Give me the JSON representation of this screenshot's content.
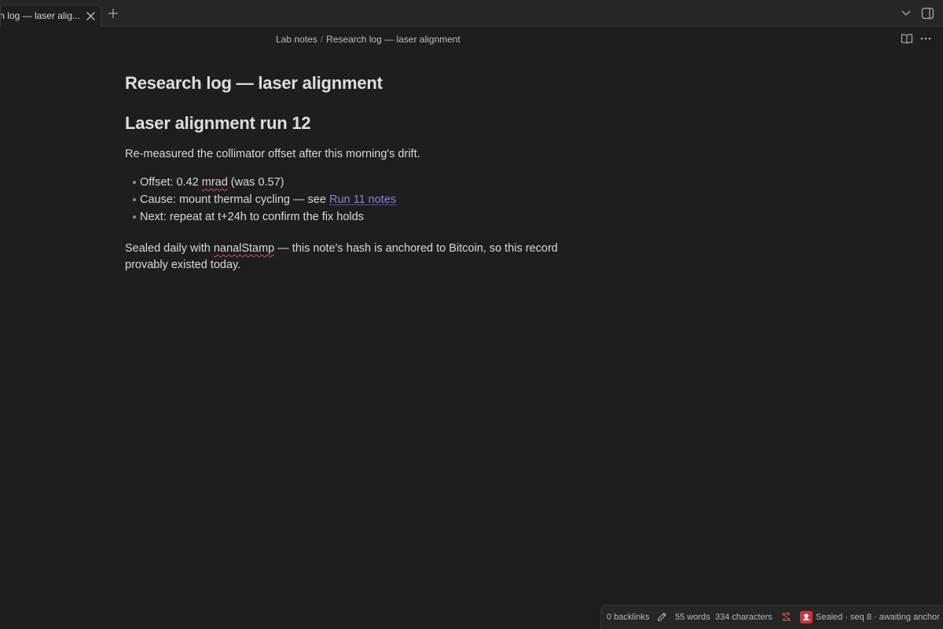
{
  "tabs": [
    {
      "title": "rch log — laser alig...",
      "active": true
    }
  ],
  "breadcrumb": {
    "folder": "Lab notes",
    "separator": "/",
    "current": "Research log — laser alignment"
  },
  "note": {
    "title": "Research log — laser alignment",
    "heading": "Laser alignment run 12",
    "intro": "Re-measured the collimator offset after this morning's drift.",
    "bullets": {
      "b1_before": "Offset: 0.42 ",
      "b1_flagged": "mrad",
      "b1_after": " (was 0.57)",
      "b2_text": "Cause: mount thermal cycling — see ",
      "b2_link": "Run 11 notes",
      "b3_text": "Next: repeat at t+24h to confirm the fix holds"
    },
    "outro_before": "Sealed daily with ",
    "outro_flagged": "nanalStamp",
    "outro_after": " — this note's hash is anchored to Bitcoin, so this record provably existed today."
  },
  "statusbar": {
    "backlinks": "0 backlinks",
    "words": "55 words",
    "characters": "334 characters",
    "stamp_status": "Sealed · seq 8 · awaiting anchor"
  },
  "icons": {
    "tab_close": "close-icon",
    "new_tab": "plus-icon",
    "tab_list": "chevron-down-icon",
    "sidebar": "sidebar-toggle-icon",
    "reading_view": "book-open-icon",
    "more": "more-horizontal-icon",
    "edit": "pencil-icon",
    "sync": "sync-off-icon",
    "stamp": "stamp-icon"
  },
  "colors": {
    "background": "#1e1e1e",
    "link": "#8c7ee0",
    "stamp_badge": "#c9363a",
    "spellcheck": "#d05050"
  }
}
